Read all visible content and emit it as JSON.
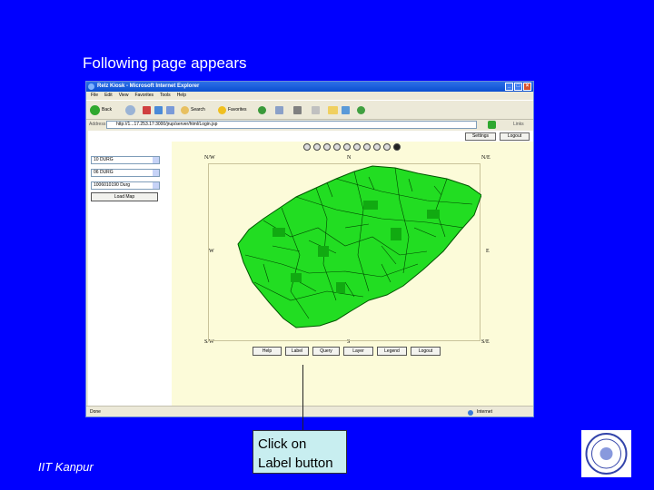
{
  "slide": {
    "title": "Following page appears",
    "footer": "IIT Kanpur",
    "callout": "Click on Label button"
  },
  "browser": {
    "title": "Relz Kiosk - Microsoft Internet Explorer",
    "menu": [
      "File",
      "Edit",
      "View",
      "Favorites",
      "Tools",
      "Help"
    ],
    "toolbar": {
      "back": "Back",
      "search": "Search",
      "favorites": "Favorites"
    },
    "address_label": "Address",
    "address": "http://1...17.253.17:3000/jrup/server/html/Login.jsp",
    "links_label": "Links",
    "status_left": "Done",
    "status_right": "Internet"
  },
  "app": {
    "settings_label": "Settings",
    "logout_label": "Logout",
    "selects": [
      "10 DURG",
      "06 DURG",
      "1006010190 Durg"
    ],
    "load_map_label": "Load Map",
    "directions": {
      "nw": "N/W",
      "n": "N",
      "ne": "N/E",
      "w": "W",
      "e": "E",
      "sw": "S/W",
      "s": "S",
      "se": "S/E"
    },
    "map_buttons": [
      "Help",
      "Label",
      "Query",
      "Layer",
      "Legend",
      "Logout"
    ],
    "map_color": "#22dd22",
    "map_outline": "#005500"
  }
}
